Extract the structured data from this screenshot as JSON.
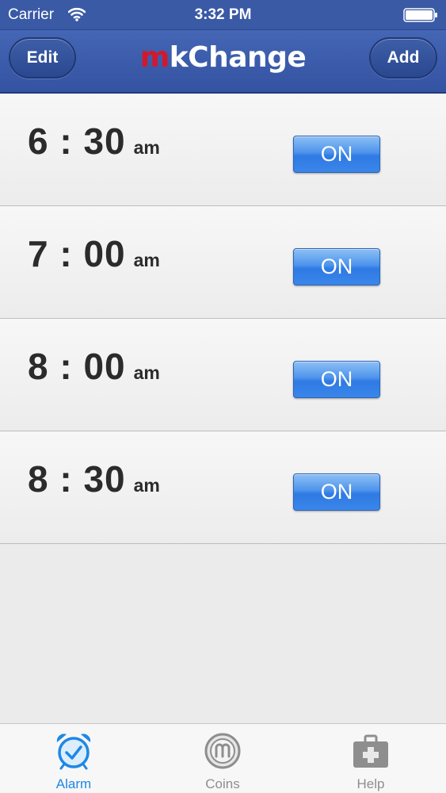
{
  "status_bar": {
    "carrier": "Carrier",
    "time": "3:32 PM"
  },
  "nav": {
    "edit_label": "Edit",
    "add_label": "Add",
    "logo_m": "m",
    "logo_rest": "kChange"
  },
  "alarms": [
    {
      "time": "6 : 30",
      "ampm": "am",
      "toggle": "ON"
    },
    {
      "time": "7 : 00",
      "ampm": "am",
      "toggle": "ON"
    },
    {
      "time": "8 : 00",
      "ampm": "am",
      "toggle": "ON"
    },
    {
      "time": "8 : 30",
      "ampm": "am",
      "toggle": "ON"
    }
  ],
  "tabs": [
    {
      "label": "Alarm",
      "icon": "alarm-clock-icon",
      "selected": true
    },
    {
      "label": "Coins",
      "icon": "coin-icon",
      "selected": false
    },
    {
      "label": "Help",
      "icon": "first-aid-kit-icon",
      "selected": false
    }
  ],
  "colors": {
    "nav_blue": "#3a5aa6",
    "toggle_blue": "#3a86ea",
    "logo_red": "#d4182a",
    "tab_active": "#1e88e5",
    "tab_inactive": "#8e8e8e"
  }
}
